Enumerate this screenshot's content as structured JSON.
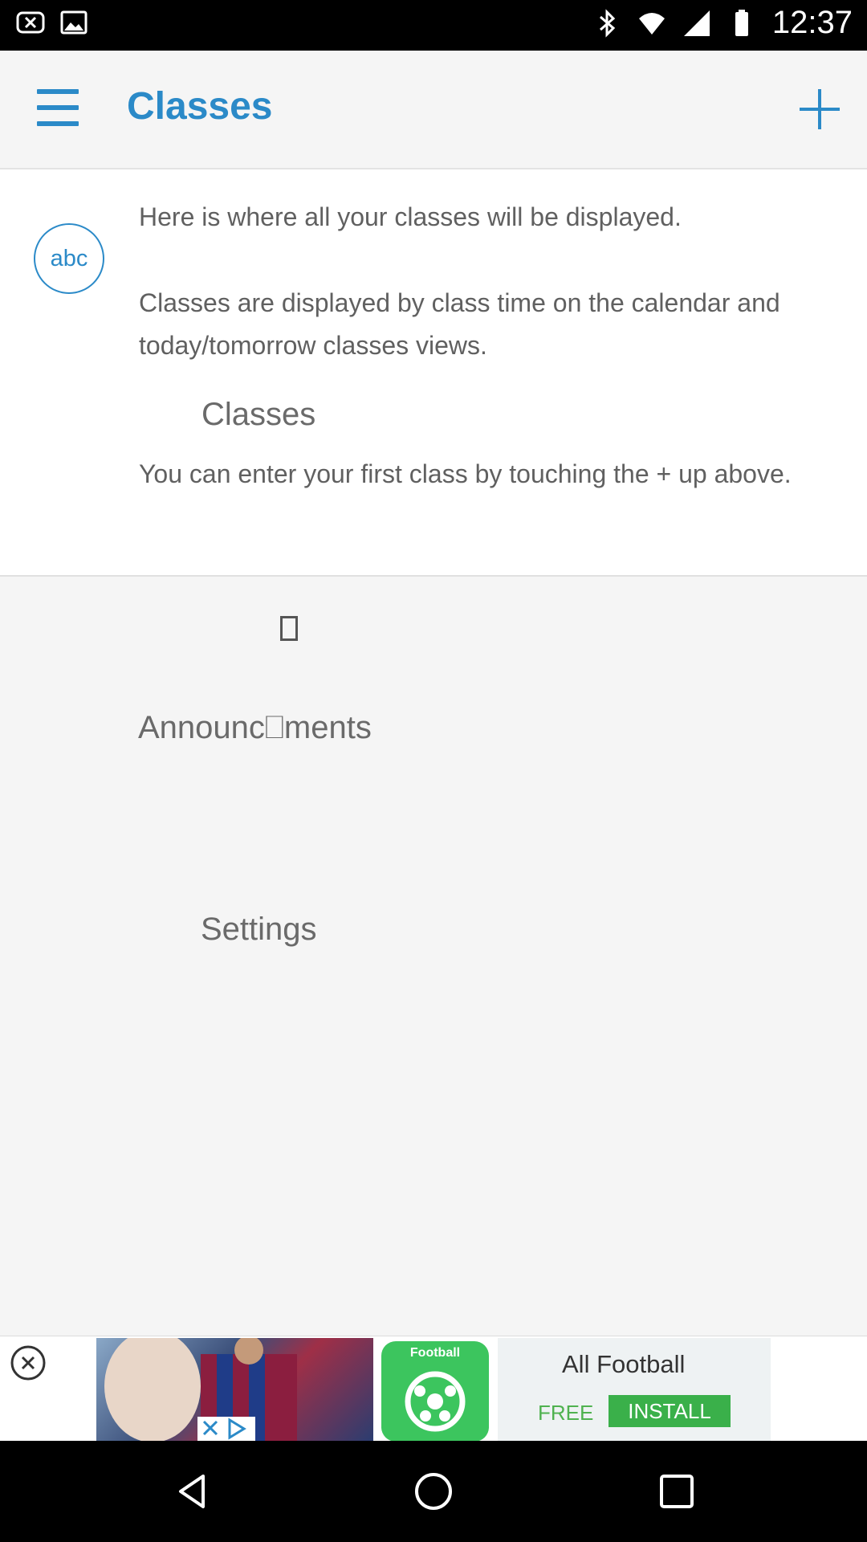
{
  "status_bar": {
    "time": "12:37",
    "left_icons": [
      "close-notification-icon",
      "image-icon"
    ],
    "right_icons": [
      "bluetooth-icon",
      "wifi-icon",
      "signal-icon",
      "battery-icon"
    ]
  },
  "app_bar": {
    "title": "Classes",
    "menu_icon": "hamburger-menu-icon",
    "add_icon": "plus-icon"
  },
  "info_card": {
    "badge": "abc",
    "line1": "Here is where all your classes will be displayed.",
    "line2": "Classes are displayed by class time on the calendar and today/tomorrow classes views.",
    "floating_label": "Classes",
    "line3": "You can enter your first class by touching the + up above."
  },
  "drawer_remnants": {
    "announcements": "Announc⎕ments",
    "settings": "Settings"
  },
  "ad": {
    "app_label": "Football",
    "title": "All Football",
    "free_label": "FREE",
    "install_label": "INSTALL"
  },
  "nav_bar": {
    "icons": [
      "back-icon",
      "home-icon",
      "recents-icon"
    ]
  },
  "colors": {
    "accent": "#2b8ac8",
    "install_green": "#3ab04a",
    "text_gray": "#606060"
  }
}
